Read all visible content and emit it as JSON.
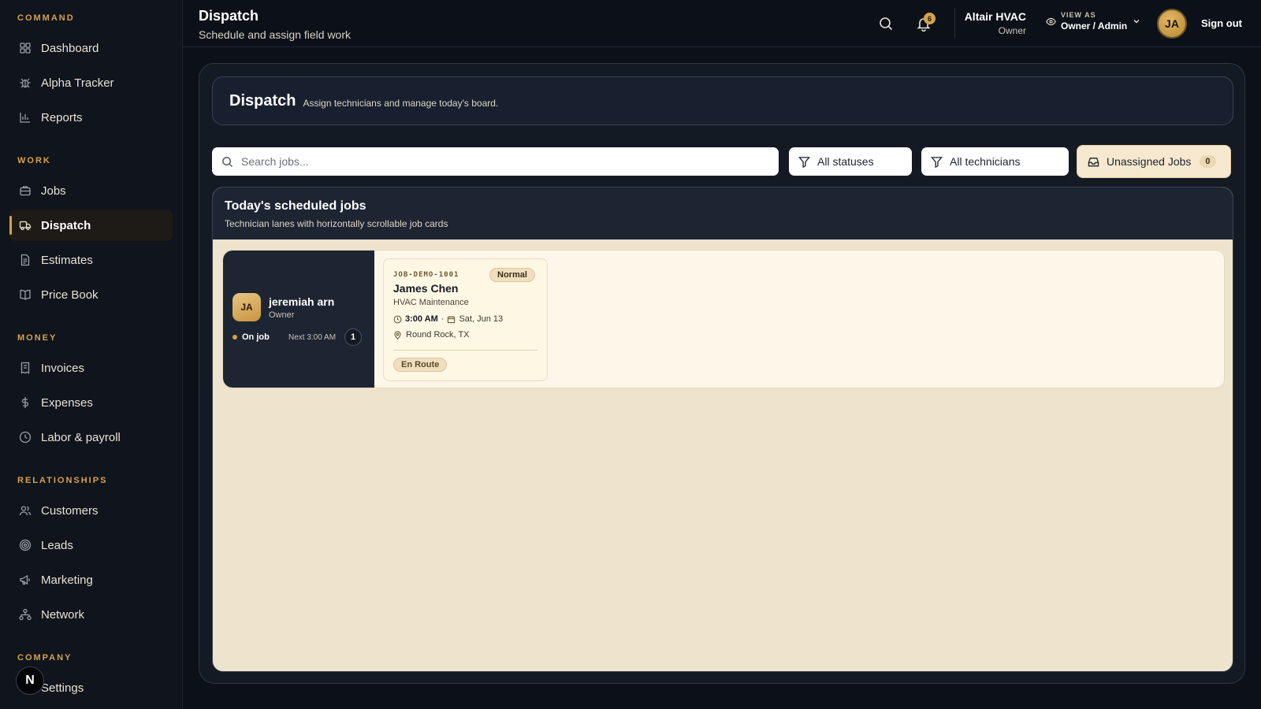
{
  "sidebar": {
    "sections": [
      {
        "label": "COMMAND"
      },
      {
        "label": "WORK"
      },
      {
        "label": "MONEY"
      },
      {
        "label": "RELATIONSHIPS"
      },
      {
        "label": "COMPANY"
      }
    ],
    "items": [
      {
        "label": "Dashboard",
        "icon": "grid-icon"
      },
      {
        "label": "Alpha Tracker",
        "icon": "bug-icon"
      },
      {
        "label": "Reports",
        "icon": "bar-chart-icon"
      },
      {
        "label": "Jobs",
        "icon": "briefcase-icon"
      },
      {
        "label": "Dispatch",
        "icon": "truck-icon",
        "active": true
      },
      {
        "label": "Estimates",
        "icon": "document-icon"
      },
      {
        "label": "Price Book",
        "icon": "book-icon"
      },
      {
        "label": "Invoices",
        "icon": "invoice-icon"
      },
      {
        "label": "Expenses",
        "icon": "dollar-icon"
      },
      {
        "label": "Labor & payroll",
        "icon": "clock-icon"
      },
      {
        "label": "Customers",
        "icon": "users-icon"
      },
      {
        "label": "Leads",
        "icon": "target-icon"
      },
      {
        "label": "Marketing",
        "icon": "megaphone-icon"
      },
      {
        "label": "Network",
        "icon": "network-icon"
      },
      {
        "label": "Settings",
        "icon": "gear-icon"
      }
    ],
    "n_badge": "N"
  },
  "topbar": {
    "title": "Dispatch",
    "subtitle": "Schedule and assign field work",
    "notifications_count": "6",
    "company_name": "Altair HVAC",
    "company_role": "Owner",
    "view_as_label": "VIEW AS",
    "view_as_value": "Owner / Admin",
    "avatar_initials": "JA",
    "sign_out": "Sign out"
  },
  "header": {
    "title": "Dispatch",
    "subtitle": "Assign technicians and manage today's board."
  },
  "filters": {
    "search_placeholder": "Search jobs...",
    "status": "All statuses",
    "technician": "All technicians",
    "unassigned_label": "Unassigned Jobs",
    "unassigned_count": "0"
  },
  "board": {
    "title": "Today's scheduled jobs",
    "subtitle": "Technician lanes with horizontally scrollable job cards",
    "lanes": [
      {
        "initials": "JA",
        "name": "jeremiah arn",
        "role": "Owner",
        "status": "On job",
        "next": "Next 3:00 AM",
        "count": "1",
        "jobs": [
          {
            "id": "JOB-DEMO-1001",
            "priority": "Normal",
            "customer": "James Chen",
            "type": "HVAC Maintenance",
            "time": "3:00 AM",
            "sep": "·",
            "date": "Sat, Jun 13",
            "location": "Round Rock, TX",
            "status": "En Route"
          }
        ]
      }
    ]
  },
  "colors": {
    "accent": "#d6a24a",
    "background": "#0c1119",
    "board": "#eee3cc"
  }
}
